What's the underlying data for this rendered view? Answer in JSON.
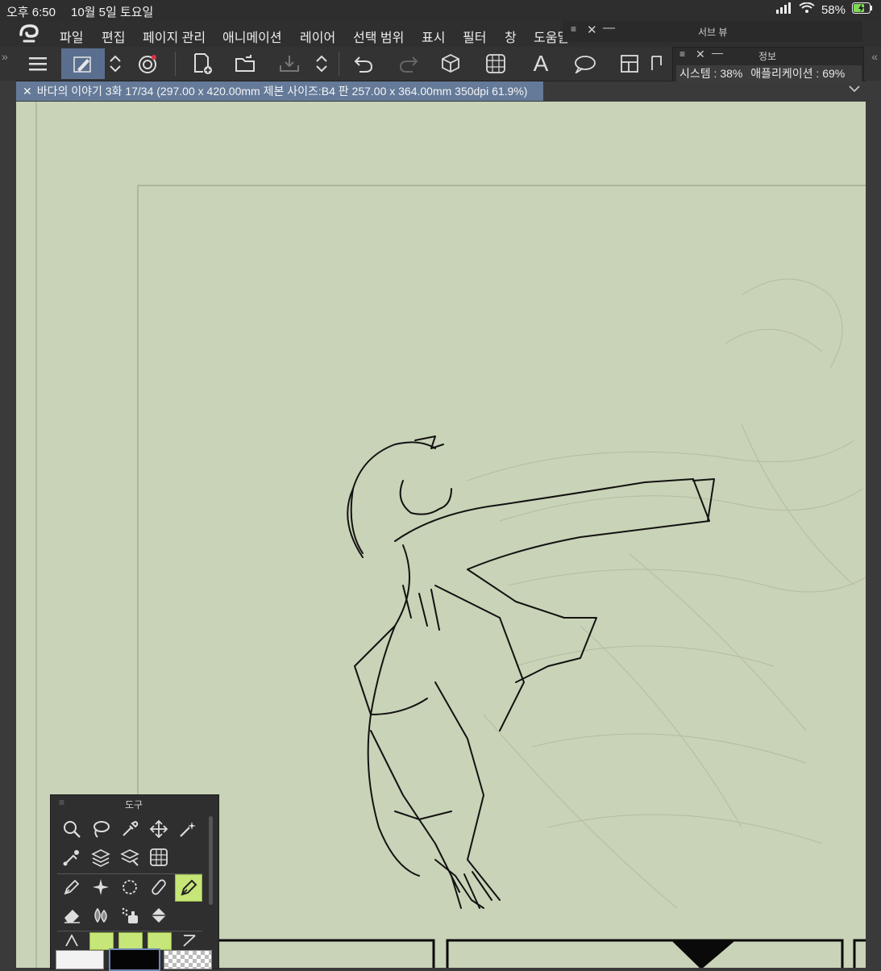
{
  "status": {
    "time": "오후 6:50",
    "date": "10월 5일 토요일",
    "battery": "58%",
    "icons": [
      "signal-icon",
      "wifi-icon",
      "battery-charging-icon"
    ]
  },
  "menu": {
    "items": [
      "파일",
      "편집",
      "페이지 관리",
      "애니메이션",
      "레이어",
      "선택 범위",
      "표시",
      "필터",
      "창",
      "도움말"
    ]
  },
  "toolbar": {
    "icons": [
      "menu-icon",
      "pen-tool-icon",
      "updown-icon",
      "brush-swap-icon",
      "new-page-icon",
      "open-folder-icon",
      "export-icon",
      "updown-icon",
      "undo-icon",
      "redo-icon",
      "3d-box-icon",
      "frame-icon",
      "text-icon",
      "balloon-icon",
      "panel-icon"
    ]
  },
  "document": {
    "tab_title": "바다의 이야기 3화 17/34 (297.00 x 420.00mm 제본 사이즈:B4 판 257.00 x 364.00mm 350dpi 61.9%)"
  },
  "subview": {
    "title": "서브 뷰"
  },
  "info": {
    "title": "정보",
    "system_label": "시스템 :",
    "system_value": "38%",
    "app_label": "애플리케이션 :",
    "app_value": "69%"
  },
  "tools_panel": {
    "title": "도구",
    "rows": [
      [
        "zoom-icon",
        "lasso-icon",
        "eyedropper-icon",
        "move-icon",
        "magic-wand-icon"
      ],
      [
        "object-select-icon",
        "layer-select-icon",
        "layer-move-icon",
        "frame-border-icon"
      ],
      [
        "pen-icon",
        "sparkle-icon",
        "rotate-icon",
        "pencil-icon",
        "ink-pen-icon"
      ],
      [
        "eraser-icon",
        "blend-icon",
        "airbrush-icon",
        "fill-bucket-icon"
      ]
    ],
    "selected": "ink-pen-icon"
  },
  "colors": {
    "canvas": "#c9d3b7",
    "chrome": "#333333",
    "accent": "#5a6f8f",
    "tool_selected": "#c6e678"
  }
}
